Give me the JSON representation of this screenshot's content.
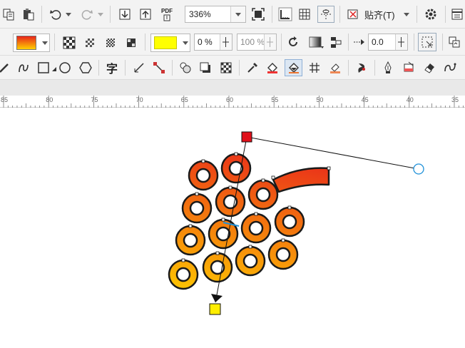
{
  "toolbar1": {
    "zoom_value": "336%",
    "paste_label": "贴齐(T)",
    "pdf_label": "PDF"
  },
  "toolbar2": {
    "fill_color": "#ffff00",
    "opacity_value": "0 %",
    "midpoint_value": "100 %",
    "offset_value": "0.0"
  },
  "toolbar3": {
    "text_tool_label": "字"
  },
  "ruler": {
    "ticks": [
      "85",
      "80",
      "75",
      "70",
      "65",
      "60",
      "55",
      "50",
      "45",
      "40",
      "35"
    ]
  },
  "colors": {
    "start_node": "#e0101a",
    "end_node": "#ffee00",
    "gradient_top": "#e8251b",
    "gradient_bottom": "#ffd000",
    "handle": "#1e90d8"
  }
}
